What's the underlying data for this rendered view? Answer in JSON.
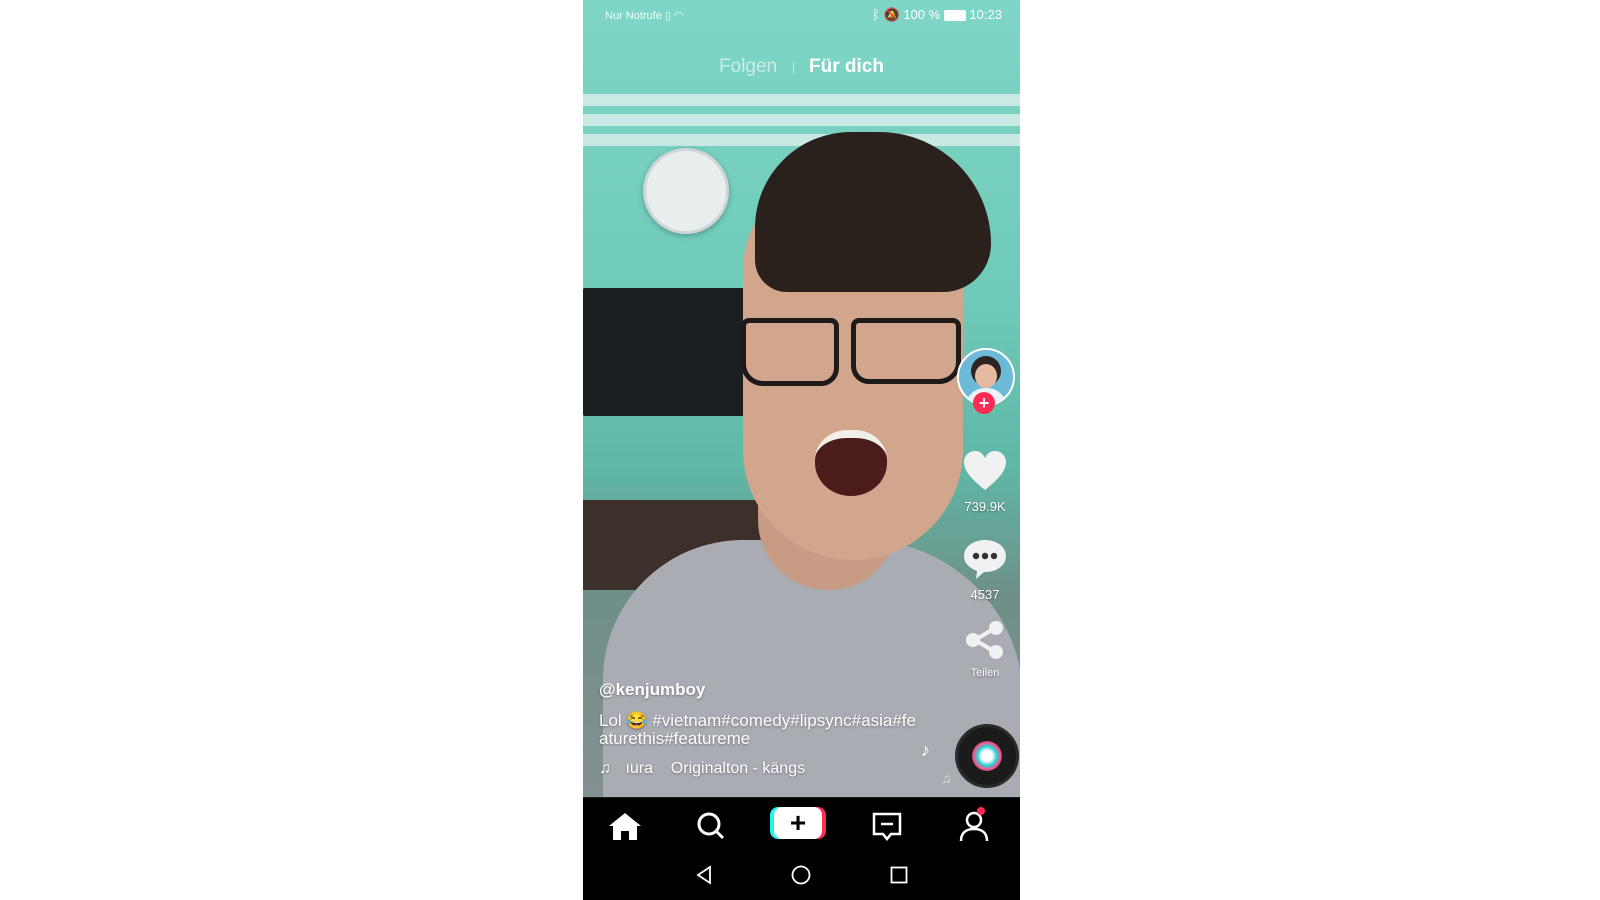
{
  "status_bar": {
    "carrier": "Nur Notrufe",
    "battery": "100 %",
    "time": "10:23"
  },
  "top_tabs": [
    {
      "label": "Folgen",
      "active": false
    },
    {
      "label": "Für dich",
      "active": true
    }
  ],
  "video": {
    "username": "@kenjumboy",
    "caption": "Lol 😂 #vietnam#comedy#lipsync#asia#featurethis#featureme",
    "music_text": "ıura    Originalton - kängs"
  },
  "actions": {
    "likes": "739.9K",
    "comments": "4537",
    "share_label": "Teilen"
  },
  "icons": {
    "like": "heart-icon",
    "comment": "comment-icon",
    "share": "share-icon",
    "music": "music-note-icon"
  },
  "bottom_nav": [
    "home-icon",
    "search-icon",
    "create-icon",
    "inbox-icon",
    "profile-icon"
  ],
  "colors": {
    "accent_red": "#fe2c55",
    "accent_cyan": "#25f4ee",
    "nav_bg": "#000000"
  }
}
